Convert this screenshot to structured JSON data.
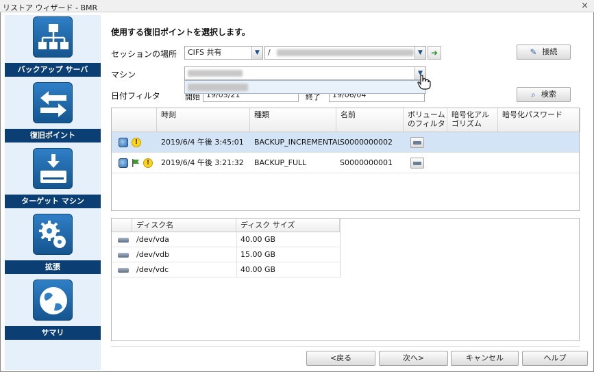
{
  "window": {
    "title": "リストア ウィザード - BMR",
    "close_glyph": "×"
  },
  "sidebar": {
    "items": [
      {
        "label": "バックアップ サーバ",
        "icon": "network-tree-icon"
      },
      {
        "label": "復旧ポイント",
        "icon": "arrows-exchange-icon"
      },
      {
        "label": "ターゲット マシン",
        "icon": "download-drive-icon"
      },
      {
        "label": "拡張",
        "icon": "gears-icon"
      },
      {
        "label": "サマリ",
        "icon": "globe-icon"
      }
    ]
  },
  "main": {
    "title": "使用する復旧ポイントを選択します。",
    "session_label": "セッションの場所",
    "session_type": "CIFS 共有",
    "session_path_prefix": "/",
    "machine_label": "マシン",
    "date_filter_label": "日付フィルタ",
    "date_start_label": "開始",
    "date_start": "19/05/21",
    "date_end_label": "終了",
    "date_end": "19/06/04",
    "connect_button": "接続",
    "search_button": "検索",
    "go_glyph": "➜"
  },
  "recovery_table": {
    "columns": [
      "時刻",
      "種類",
      "名前",
      "ボリューム\nのフィルタ",
      "暗号化アル\nゴリズム",
      "暗号化パスワード"
    ],
    "rows": [
      {
        "time": "2019/6/4 午後 3:45:01",
        "type": "BACKUP_INCREMENTAL",
        "name": "S0000000002",
        "selected": true,
        "icons": [
          "globe-icon",
          "warning-icon"
        ]
      },
      {
        "time": "2019/6/4 午後 3:21:32",
        "type": "BACKUP_FULL",
        "name": "S0000000001",
        "selected": false,
        "icons": [
          "globe-icon",
          "flag-icon",
          "warning-icon"
        ]
      }
    ],
    "warning_glyph": "!"
  },
  "disk_table": {
    "columns": [
      "ディスク名",
      "ディスク サイズ"
    ],
    "rows": [
      {
        "name": "/dev/vda",
        "size": "40.00 GB"
      },
      {
        "name": "/dev/vdb",
        "size": "15.00 GB"
      },
      {
        "name": "/dev/vdc",
        "size": "40.00 GB"
      }
    ]
  },
  "footer": {
    "back": "<戻る",
    "next": "次へ>",
    "cancel": "キャンセル",
    "help": "ヘルプ"
  },
  "colors": {
    "nav_label_bg": "#0b3e73",
    "sidebar_bg": "#e6f0fa",
    "selected_row": "#d4e4f7",
    "icon_blue": "#2f7fc6"
  }
}
